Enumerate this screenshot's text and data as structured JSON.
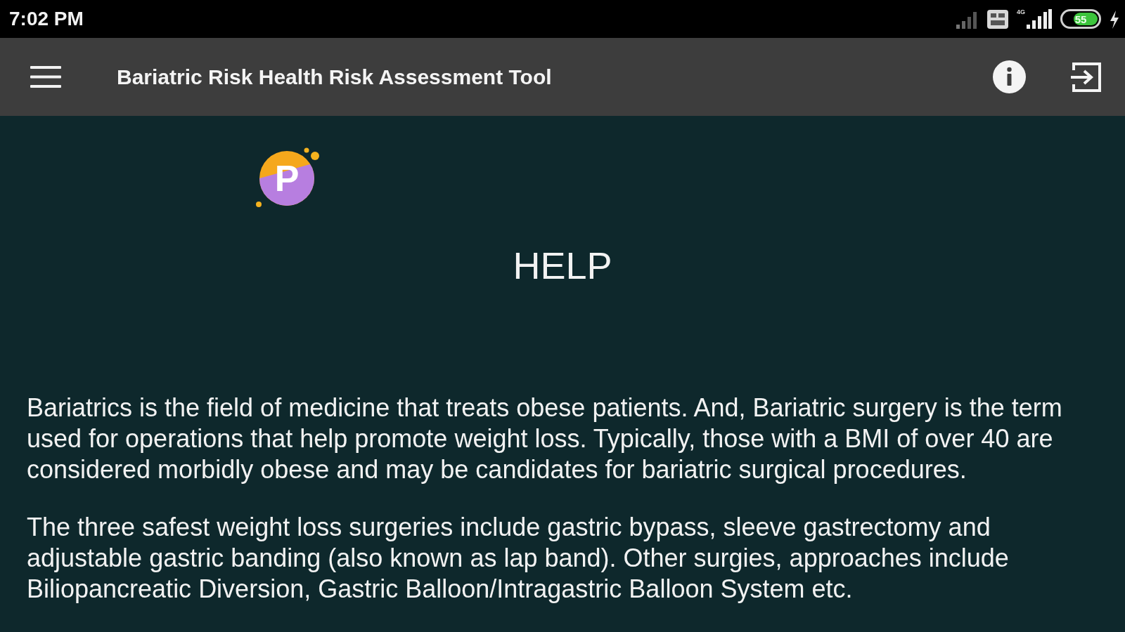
{
  "status_bar": {
    "time": "7:02 PM",
    "network_type": "4G",
    "battery_text": "55"
  },
  "app_bar": {
    "title": "Bariatric Risk Health Risk Assessment Tool"
  },
  "logo": {
    "letter": "P"
  },
  "heading": "HELP",
  "paragraphs": [
    "Bariatrics is the field of medicine that treats obese patients. And, Bariatric surgery is the term used for operations that help promote weight loss. Typically, those with a BMI of over 40 are considered morbidly obese and may be candidates for bariatric surgical procedures.",
    "The three safest weight loss surgeries include gastric bypass, sleeve gastrectomy and adjustable gastric banding (also known as lap band). Other surgies, approaches include Biliopancreatic Diversion, Gastric Balloon/Intragastric Balloon System etc."
  ]
}
